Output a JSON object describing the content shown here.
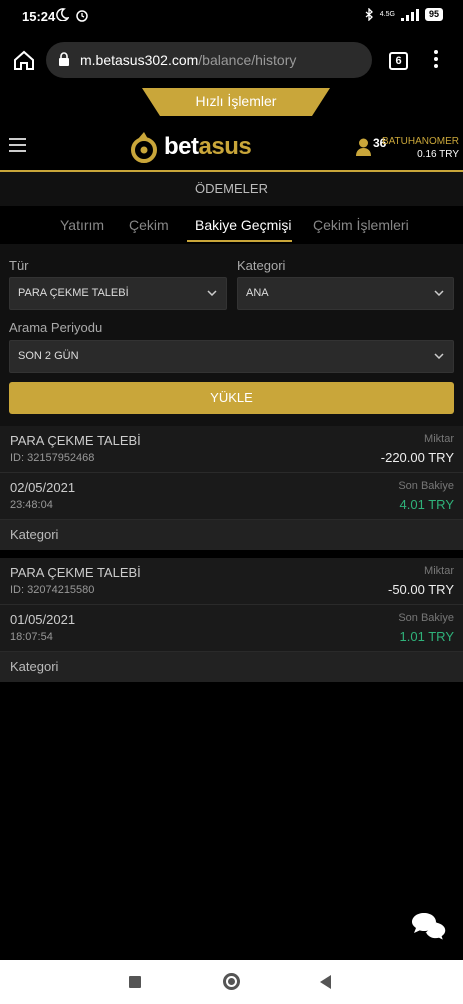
{
  "status_bar": {
    "time": "15:24",
    "network_label": "4.5G",
    "battery": "95"
  },
  "browser": {
    "url_host": "m.betasus302.com",
    "url_path": "/balance/history",
    "tab_count": "6"
  },
  "quick_actions": {
    "label": "Hızlı İşlemler"
  },
  "header": {
    "logo_prefix": "bet",
    "logo_suffix": "asus",
    "user_count": "36",
    "username": "BATUHANOMER",
    "balance": "0.16 TRY",
    "accent_color": "#c9a63a"
  },
  "page": {
    "title": "ÖDEMELER"
  },
  "tabs": [
    {
      "label": "Yatırım"
    },
    {
      "label": "Çekim"
    },
    {
      "label": "Bakiye Geçmişi"
    },
    {
      "label": "Çekim İşlemleri"
    }
  ],
  "filters": {
    "type_label": "Tür",
    "type_value": "PARA ÇEKME TALEBİ",
    "category_label": "Kategori",
    "category_value": "ANA",
    "period_label": "Arama Periyodu",
    "period_value": "SON 2 GÜN",
    "load_button": "YÜKLE"
  },
  "records": [
    {
      "title": "PARA ÇEKME TALEBİ",
      "id": "ID: 32157952468",
      "amount_label": "Miktar",
      "amount": "-220.00 TRY",
      "date": "02/05/2021",
      "time": "23:48:04",
      "balance_label": "Son Bakiye",
      "balance": "4.01 TRY",
      "category_label": "Kategori"
    },
    {
      "title": "PARA ÇEKME TALEBİ",
      "id": "ID: 32074215580",
      "amount_label": "Miktar",
      "amount": "-50.00 TRY",
      "date": "01/05/2021",
      "time": "18:07:54",
      "balance_label": "Son Bakiye",
      "balance": "1.01 TRY",
      "category_label": "Kategori"
    }
  ]
}
